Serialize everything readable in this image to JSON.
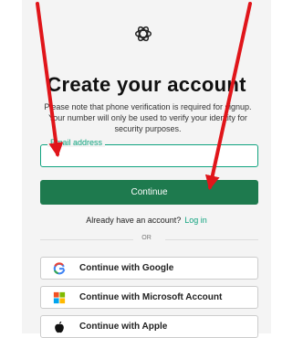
{
  "signup": {
    "title": "Create your account",
    "note": "Please note that phone verification is required for signup. Your number will only be used to verify your identity for security purposes.",
    "email_label": "Email address",
    "email_value": "",
    "continue_label": "Continue",
    "already_text": "Already have an account?",
    "login_link": "Log in",
    "or_text": "OR",
    "google_label": "Continue with Google",
    "microsoft_label": "Continue with Microsoft Account",
    "apple_label": "Continue with Apple"
  },
  "icons": {
    "logo": "openai-logo-icon",
    "google": "google-icon",
    "microsoft": "microsoft-icon",
    "apple": "apple-icon"
  },
  "colors": {
    "accent": "#10a37f",
    "primary_button": "#1e7a4e",
    "annotation_arrow": "#e0151a"
  }
}
